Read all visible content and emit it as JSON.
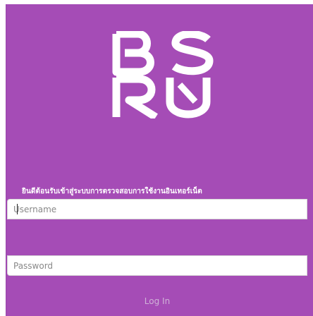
{
  "brand": {
    "logo_text": "BSRU"
  },
  "login": {
    "welcome": "ยินดีต้อนรับเข้าสู่ระบบการตรวจสอบการใช้งานอินเทอร์เน็ต",
    "username_placeholder": "Username",
    "password_placeholder": "Password",
    "button_label": "Log In"
  },
  "colors": {
    "background": "#a54cb6",
    "logo": "#ffffff",
    "button_text": "#d0b2d8"
  }
}
